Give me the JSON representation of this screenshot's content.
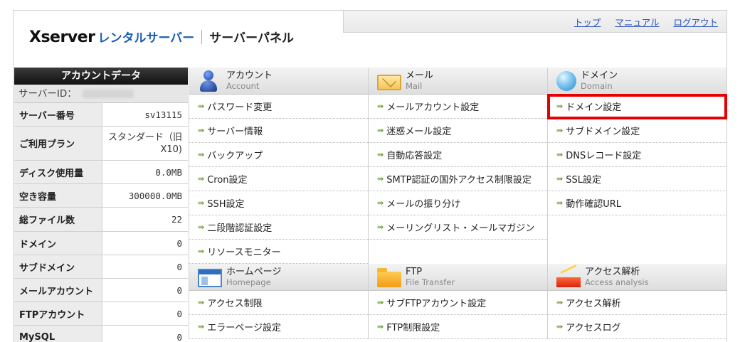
{
  "header": {
    "logo_main": "Xserver",
    "logo_sub": "レンタルサーバー",
    "panel_title": "サーバーパネル",
    "links": [
      "トップ",
      "マニュアル",
      "ログアウト"
    ]
  },
  "sidebar": {
    "title": "アカウントデータ",
    "server_id_label": "サーバーID：",
    "rows": [
      {
        "key": "サーバー番号",
        "value": "sv13115"
      },
      {
        "key": "ご利用プラン",
        "value": "スタンダード（旧\nX10)"
      },
      {
        "key": "ディスク使用量",
        "value": "0.0MB"
      },
      {
        "key": "空き容量",
        "value": "300000.0MB"
      },
      {
        "key": "総ファイル数",
        "value": "22"
      },
      {
        "key": "ドメイン",
        "value": "0"
      },
      {
        "key": "サブドメイン",
        "value": "0"
      },
      {
        "key": "メールアカウント",
        "value": "0"
      },
      {
        "key": "FTPアカウント",
        "value": "0"
      },
      {
        "key": "MySQL",
        "value": "0"
      }
    ]
  },
  "sections_top": [
    {
      "title": "アカウント",
      "sub": "Account",
      "icon": "account-icon"
    },
    {
      "title": "メール",
      "sub": "Mail",
      "icon": "mail-icon"
    },
    {
      "title": "ドメイン",
      "sub": "Domain",
      "icon": "domain-globe-icon"
    }
  ],
  "menu_top": [
    [
      "パスワード変更",
      "サーバー情報",
      "バックアップ",
      "Cron設定",
      "SSH設定",
      "二段階認証設定",
      "リソースモニター"
    ],
    [
      "メールアカウント設定",
      "迷惑メール設定",
      "自動応答設定",
      "SMTP認証の国外アクセス制限設定",
      "メールの振り分け",
      "メーリングリスト・メールマガジン",
      ""
    ],
    [
      "ドメイン設定",
      "サブドメイン設定",
      "DNSレコード設定",
      "SSL設定",
      "動作確認URL",
      "",
      ""
    ]
  ],
  "sections_bottom": [
    {
      "title": "ホームページ",
      "sub": "Homepage",
      "icon": "homepage-icon"
    },
    {
      "title": "FTP",
      "sub": "File Transfer",
      "icon": "ftp-folder-icon"
    },
    {
      "title": "アクセス解析",
      "sub": "Access analysis",
      "icon": "access-analysis-icon"
    }
  ],
  "menu_bottom": [
    [
      "アクセス制限",
      "エラーページ設定"
    ],
    [
      "サブFTPアカウント設定",
      "FTP制限設定"
    ],
    [
      "アクセス解析",
      "アクセスログ"
    ]
  ],
  "arrow_glyph": "⇛",
  "highlight_color": "#e60000"
}
